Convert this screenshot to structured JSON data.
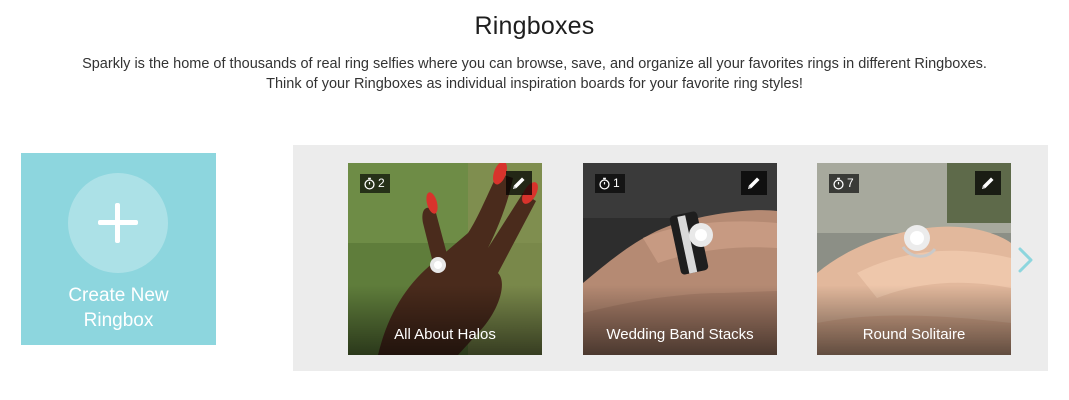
{
  "header": {
    "title": "Ringboxes",
    "intro_line1": "Sparkly is the home of thousands of real ring selfies where you can browse, save, and organize all your favorites rings in different Ringboxes.",
    "intro_line2": "Think of your Ringboxes as individual inspiration boards for your favorite ring styles!"
  },
  "create": {
    "label_line1": "Create New",
    "label_line2": "Ringbox",
    "icon": "plus-icon",
    "color": "#8dd6de"
  },
  "ringboxes": [
    {
      "title": "All About Halos",
      "count": "2",
      "count_icon": "stopwatch-icon",
      "edit_icon": "pencil-icon"
    },
    {
      "title": "Wedding Band Stacks",
      "count": "1",
      "count_icon": "stopwatch-icon",
      "edit_icon": "pencil-icon"
    },
    {
      "title": "Round Solitaire",
      "count": "7",
      "count_icon": "stopwatch-icon",
      "edit_icon": "pencil-icon"
    }
  ],
  "carousel": {
    "next_icon": "chevron-right-icon",
    "accent_color": "#8dd6de",
    "background": "#ececec"
  }
}
